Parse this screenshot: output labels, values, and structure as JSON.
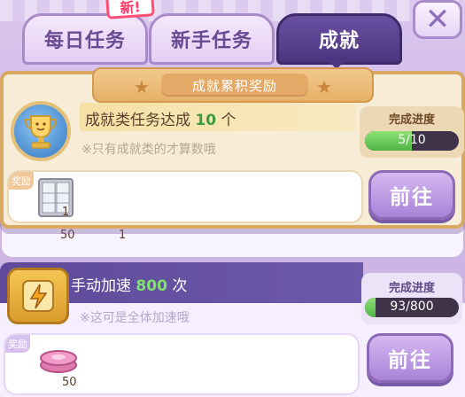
{
  "tabs": [
    {
      "label": "每日任务",
      "active": false
    },
    {
      "label": "新手任务",
      "active": false
    },
    {
      "label": "成就",
      "active": true
    }
  ],
  "new_badge": "新!",
  "close_icon": "close-x-icon",
  "banner": {
    "title": "成就累积奖励"
  },
  "achievement_task": {
    "prefix": "成就类任务达成",
    "count": "10",
    "suffix": "个",
    "note": "※只有成就类的才算数哦",
    "progress_label": "完成进度",
    "progress_text": "5/10",
    "progress_fraction": 0.5,
    "reward_tag": "奖励",
    "reward_item_icon": "display-cabinet-icon",
    "reward_qty": "1",
    "go_label": "前往"
  },
  "hidden_row": {
    "qty_a": "50",
    "qty_b": "1"
  },
  "speedup_task": {
    "prefix": "手动加速",
    "count": "800",
    "suffix": "次",
    "note": "※这可是全体加速哦",
    "progress_label": "完成进度",
    "progress_text": "93/800",
    "progress_fraction": 0.116,
    "reward_tag": "奖励",
    "reward_item_icon": "pink-coins-icon",
    "reward_qty": "50",
    "go_label": "前往"
  },
  "colors": {
    "accent_purple": "#4c3680",
    "progress_green": "#4fb447",
    "highlight_gold": "#d9a964"
  }
}
